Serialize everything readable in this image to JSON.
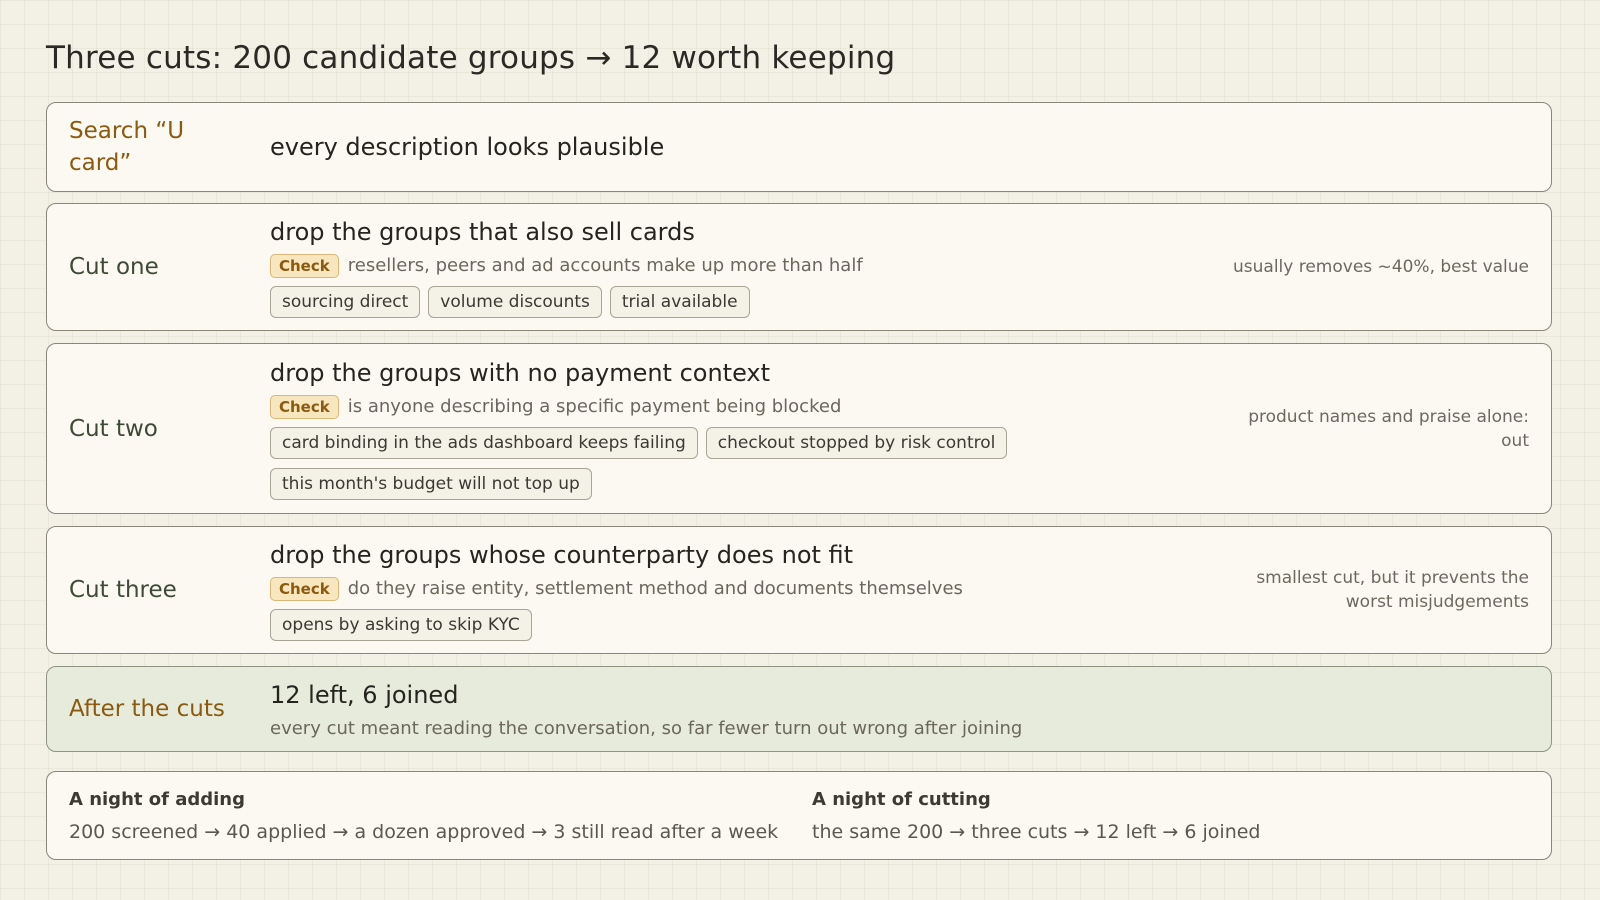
{
  "title": "Three cuts: 200 candidate groups → 12 worth keeping",
  "search": {
    "label": "Search “U card”",
    "text": "every description looks plausible"
  },
  "cuts": [
    {
      "label": "Cut one",
      "headline": "drop the groups that also sell cards",
      "check_label": "Check",
      "check_text": "resellers, peers and ad accounts make up more than half",
      "tags": [
        "sourcing direct",
        "volume discounts",
        "trial available"
      ],
      "note": "usually removes ~40%, best value"
    },
    {
      "label": "Cut two",
      "headline": "drop the groups with no payment context",
      "check_label": "Check",
      "check_text": "is anyone describing a specific payment being blocked",
      "tags": [
        "card binding in the ads dashboard keeps failing",
        "checkout stopped by risk control",
        "this month's budget will not top up"
      ],
      "note": "product names and praise alone: out"
    },
    {
      "label": "Cut three",
      "headline": "drop the groups whose counterparty does not fit",
      "check_label": "Check",
      "check_text": "do they raise entity, settlement method and documents themselves",
      "tags": [
        "opens by asking to skip KYC"
      ],
      "note": "smallest cut, but it prevents the worst misjudgements"
    }
  ],
  "result": {
    "label": "After the cuts",
    "headline": "12 left, 6 joined",
    "text": "every cut meant reading the conversation, so far fewer turn out wrong after joining"
  },
  "comparison": {
    "adding": {
      "title": "A night of adding",
      "text": "200 screened → 40 applied → a dozen approved → 3 still read after a week"
    },
    "cutting": {
      "title": "A night of cutting",
      "text": "the same 200 → three cuts → 12 left → 6 joined"
    }
  },
  "colors": {
    "background": "#f3f0e6",
    "card": "#fbf9f1",
    "result_card": "#e7ebdb",
    "accent_label": "#8a5a10",
    "check_badge_bg": "#f8e6bf"
  }
}
